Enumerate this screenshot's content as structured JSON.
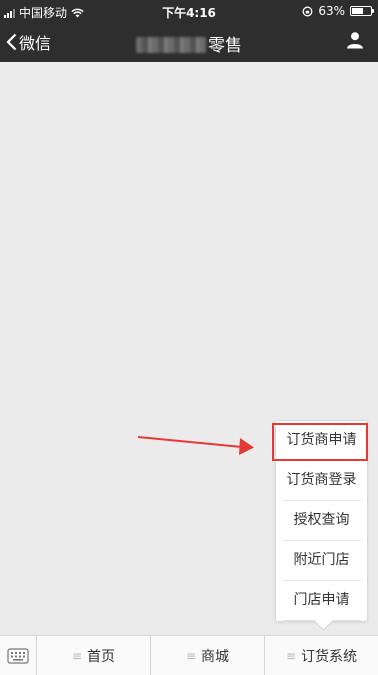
{
  "status_bar": {
    "carrier": "中国移动",
    "time": "下午4:16",
    "battery": "63%",
    "battery_level": 0.63
  },
  "nav": {
    "back_label": "微信",
    "title_suffix": "零售"
  },
  "popup_menu": {
    "items": [
      "订货商申请",
      "订货商登录",
      "授权查询",
      "附近门店",
      "门店申请"
    ],
    "highlight_color": "#e53935"
  },
  "tab_bar": {
    "tabs": [
      "首页",
      "商城",
      "订货系统"
    ]
  },
  "icons": [
    "signal-icon",
    "wifi-icon",
    "lock-rotation-icon",
    "battery-icon",
    "back-chevron-icon",
    "profile-icon",
    "keyboard-icon",
    "menu-icon",
    "arrow-icon"
  ]
}
